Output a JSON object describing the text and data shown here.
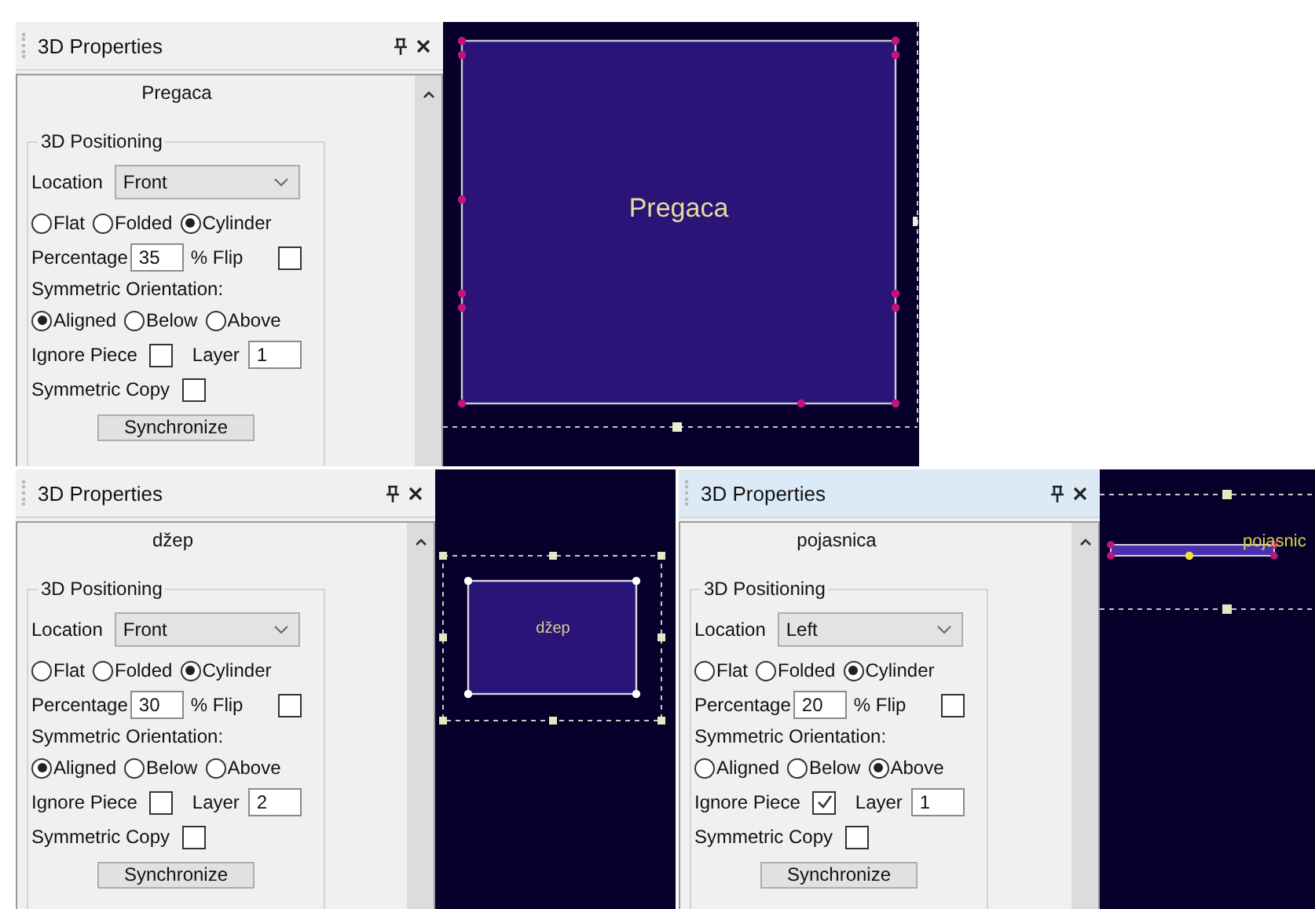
{
  "shots": [
    {
      "panel": {
        "title": "3D Properties",
        "focused": false,
        "piece_name": "Pregaca",
        "group_title": "3D Positioning",
        "location_label": "Location",
        "location_value": "Front",
        "shape_options": [
          {
            "label": "Flat",
            "selected": false
          },
          {
            "label": "Folded",
            "selected": false
          },
          {
            "label": "Cylinder",
            "selected": true
          }
        ],
        "percentage_label": "Percentage",
        "percentage_value": "35",
        "flip_label": "% Flip",
        "flip_checked": false,
        "orientation_label": "Symmetric Orientation:",
        "orientation_options": [
          {
            "label": "Aligned",
            "selected": true
          },
          {
            "label": "Below",
            "selected": false
          },
          {
            "label": "Above",
            "selected": false
          }
        ],
        "ignore_label": "Ignore Piece",
        "ignore_checked": false,
        "layer_label": "Layer",
        "layer_value": "1",
        "copy_label": "Symmetric Copy",
        "copy_checked": false,
        "sync_button": "Synchronize"
      },
      "canvas": {
        "kind": "large",
        "label": "Pregaca"
      }
    },
    {
      "panel": {
        "title": "3D Properties",
        "focused": false,
        "piece_name": "džep",
        "group_title": "3D Positioning",
        "location_label": "Location",
        "location_value": "Front",
        "shape_options": [
          {
            "label": "Flat",
            "selected": false
          },
          {
            "label": "Folded",
            "selected": false
          },
          {
            "label": "Cylinder",
            "selected": true
          }
        ],
        "percentage_label": "Percentage",
        "percentage_value": "30",
        "flip_label": "% Flip",
        "flip_checked": false,
        "orientation_label": "Symmetric Orientation:",
        "orientation_options": [
          {
            "label": "Aligned",
            "selected": true
          },
          {
            "label": "Below",
            "selected": false
          },
          {
            "label": "Above",
            "selected": false
          }
        ],
        "ignore_label": "Ignore Piece",
        "ignore_checked": false,
        "layer_label": "Layer",
        "layer_value": "2",
        "copy_label": "Symmetric Copy",
        "copy_checked": false,
        "sync_button": "Synchronize"
      },
      "canvas": {
        "kind": "pocket",
        "label": "džep"
      }
    },
    {
      "panel": {
        "title": "3D Properties",
        "focused": true,
        "piece_name": "pojasnica",
        "group_title": "3D Positioning",
        "location_label": "Location",
        "location_value": "Left",
        "shape_options": [
          {
            "label": "Flat",
            "selected": false
          },
          {
            "label": "Folded",
            "selected": false
          },
          {
            "label": "Cylinder",
            "selected": true
          }
        ],
        "percentage_label": "Percentage",
        "percentage_value": "20",
        "flip_label": "% Flip",
        "flip_checked": false,
        "orientation_label": "Symmetric Orientation:",
        "orientation_options": [
          {
            "label": "Aligned",
            "selected": false
          },
          {
            "label": "Below",
            "selected": false
          },
          {
            "label": "Above",
            "selected": true
          }
        ],
        "ignore_label": "Ignore Piece",
        "ignore_checked": true,
        "layer_label": "Layer",
        "layer_value": "1",
        "copy_label": "Symmetric Copy",
        "copy_checked": false,
        "sync_button": "Synchronize"
      },
      "canvas": {
        "kind": "strip",
        "label": "pojasnic"
      }
    }
  ]
}
